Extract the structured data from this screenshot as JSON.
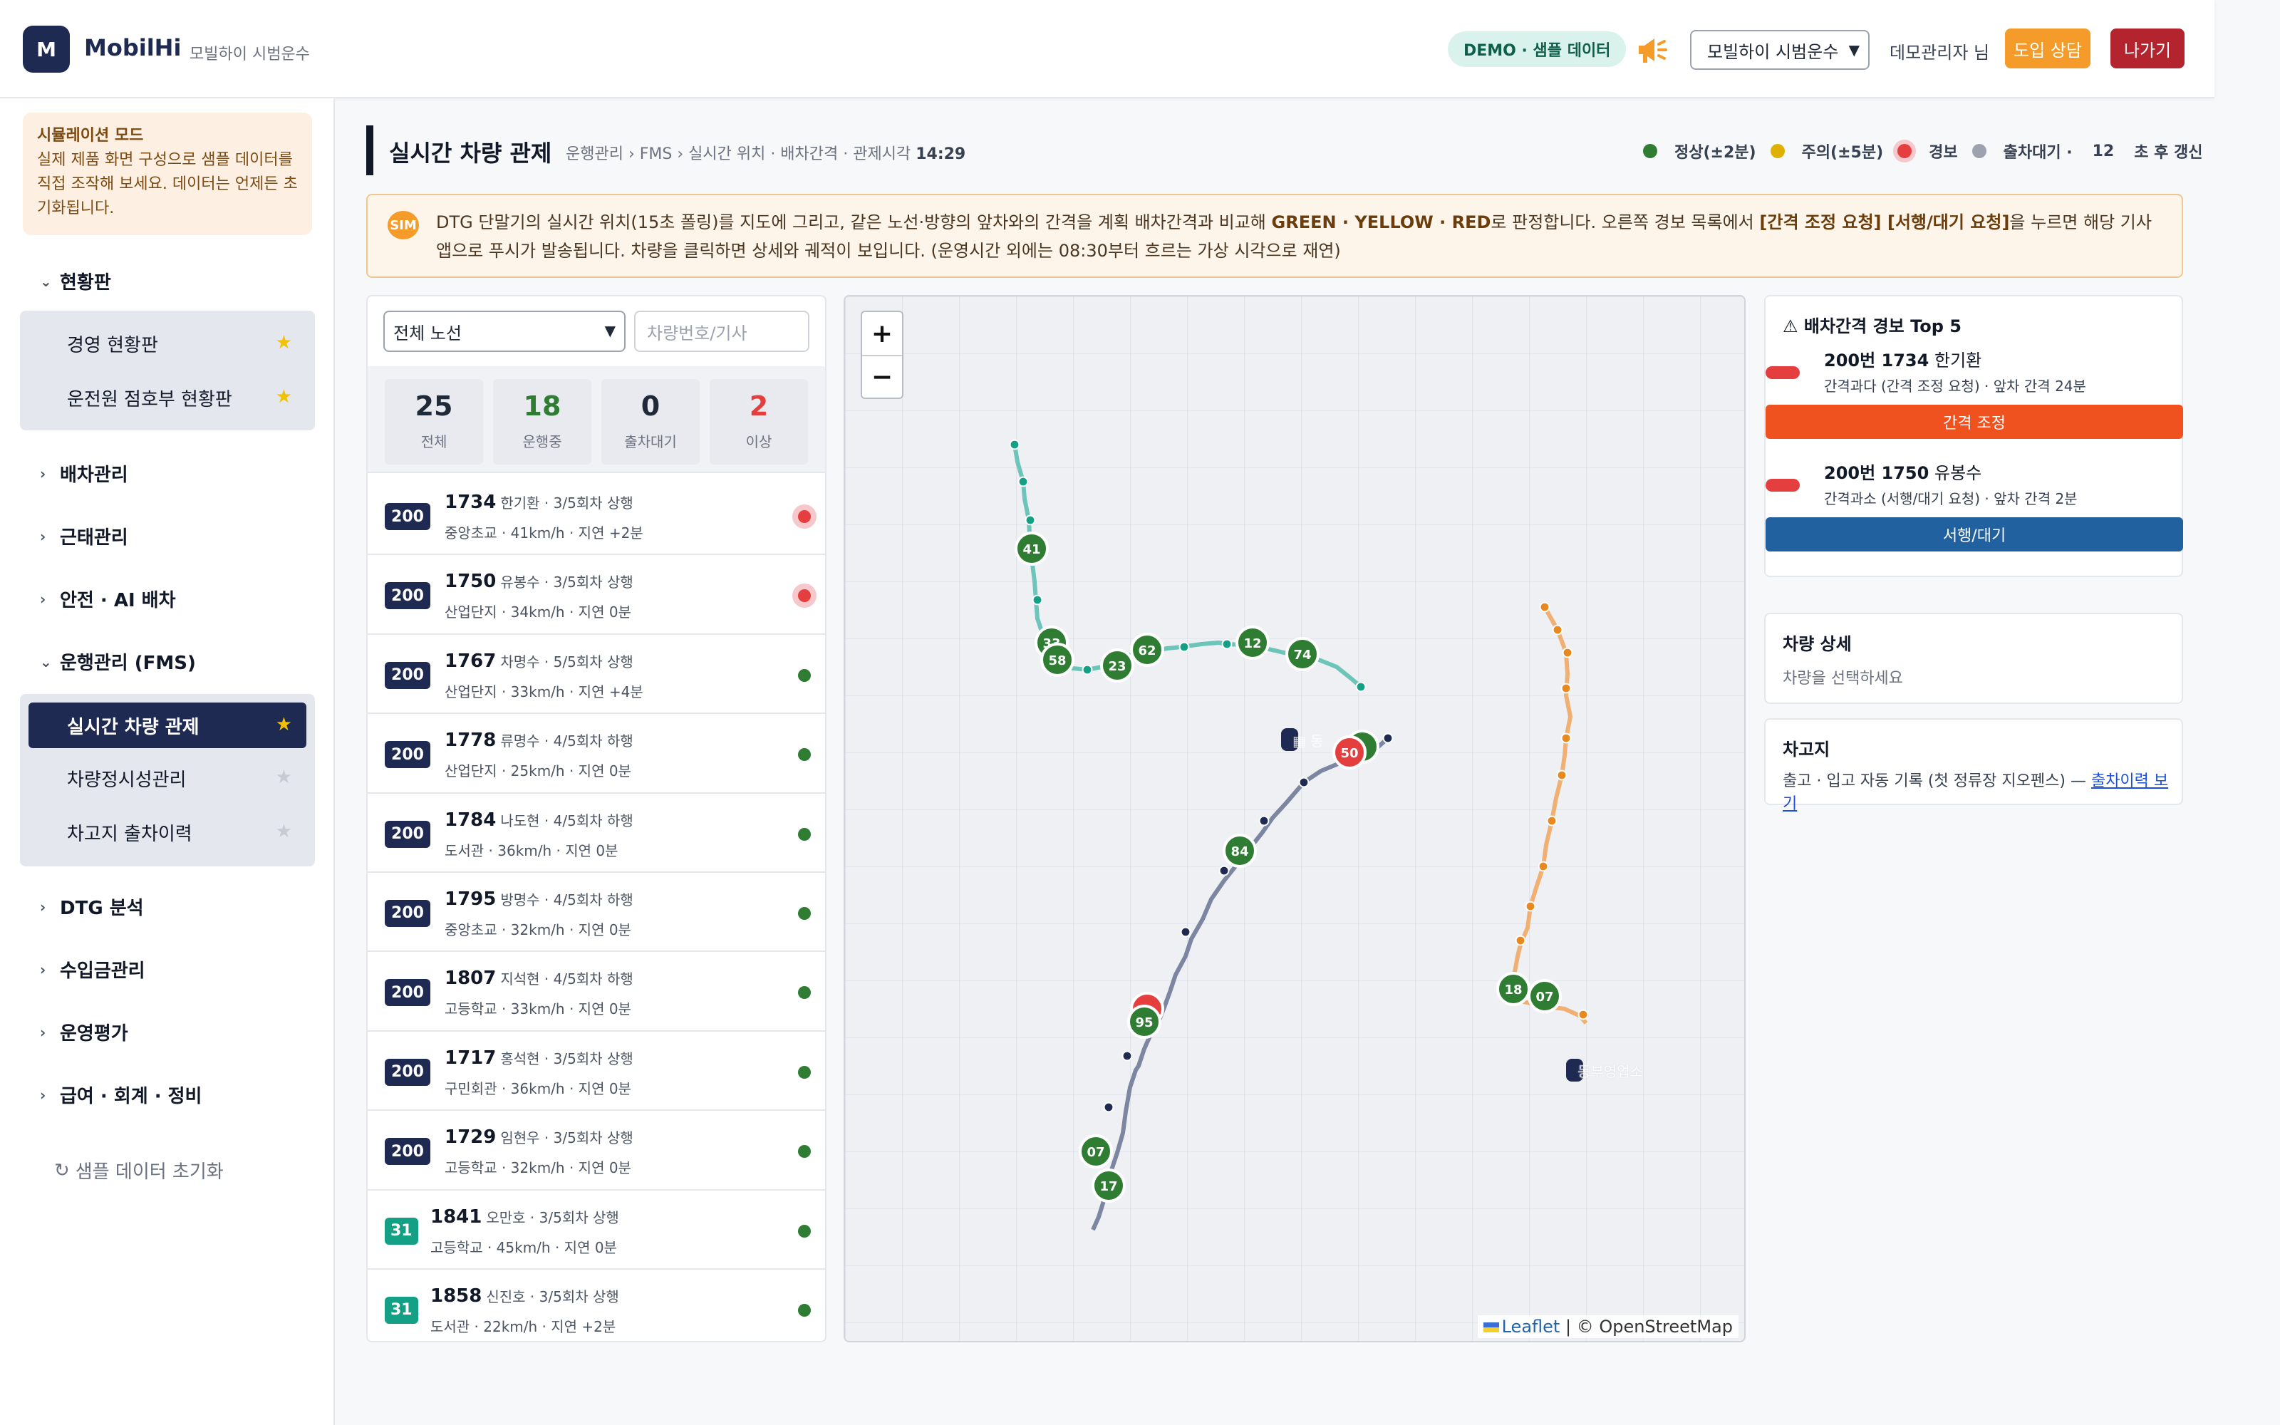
{
  "header": {
    "logo_letter": "M",
    "brand": "MobilHi",
    "brand_sub": "모빌하이 시범운수",
    "demo_badge": "DEMO · 샘플 데이터",
    "company_select": "모빌하이 시범운수",
    "admin": "데모관리자 님",
    "consult_button": "도입 상담",
    "exit_button": "나가기"
  },
  "sidebar": {
    "sim_title": "시뮬레이션 모드",
    "sim_text": "실제 제품 화면 구성으로 샘플 데이터를 직접 조작해 보세요. 데이터는 언제든 초기화됩니다.",
    "sections": [
      {
        "label": "현황판",
        "expanded": true,
        "items": [
          {
            "label": "경영 현황판",
            "starred": true
          },
          {
            "label": "운전원 점호부 현황판",
            "starred": true
          }
        ]
      },
      {
        "label": "배차관리",
        "expanded": false
      },
      {
        "label": "근태관리",
        "expanded": false
      },
      {
        "label": "안전 · AI 배차",
        "expanded": false
      },
      {
        "label": "운행관리 (FMS)",
        "expanded": true,
        "items": [
          {
            "label": "실시간 차량 관제",
            "starred": true,
            "active": true
          },
          {
            "label": "차량정시성관리",
            "starred": false
          },
          {
            "label": "차고지 출차이력",
            "starred": false
          }
        ]
      },
      {
        "label": "DTG 분석",
        "expanded": false
      },
      {
        "label": "수입금관리",
        "expanded": false
      },
      {
        "label": "운영평가",
        "expanded": false
      },
      {
        "label": "급여 · 회계 · 정비",
        "expanded": false
      }
    ],
    "reset_label": "샘플 데이터 초기화"
  },
  "page": {
    "title": "실시간 차량 관제",
    "breadcrumb": "운행관리 › FMS › 실시간 위치 · 배차간격 · 관제시각",
    "clock": "14:29",
    "legend": [
      {
        "label": "정상(±2분)",
        "color": "#2e7d32"
      },
      {
        "label": "주의(±5분)",
        "color": "#e0b000"
      },
      {
        "label": "경보",
        "color": "#e53e3e"
      },
      {
        "label": "출차대기 ·",
        "color": "#9ca3af"
      }
    ],
    "refresh_count": "12",
    "refresh_label": "초 후 갱신"
  },
  "banner": {
    "badge": "SIM",
    "t1": "DTG 단말기의 실시간 위치(15초 폴링)를 지도에 그리고, 같은 노선·방향의 앞차와의 간격을 계획 배차간격과 비교해 ",
    "t2": "GREEN · YELLOW · RED",
    "t3": "로 판정합니다. 오른쪽 경보 목록에서 ",
    "t4": "[간격 조정 요청] [서행/대기 요청]",
    "t5": "을 누르면 해당 기사 앱으로 푸시가 발송됩니다. 차량을 클릭하면 상세와 궤적이 보입니다. (운영시간 외에는 08:30부터 흐르는 가상 시각으로 재연)"
  },
  "list": {
    "route_select": "전체 노선",
    "search_placeholder": "차량번호/기사",
    "stats": [
      {
        "value": "25",
        "label": "전체",
        "color": "#1f2937"
      },
      {
        "value": "18",
        "label": "운행중",
        "color": "#2e7d32"
      },
      {
        "value": "0",
        "label": "출차대기",
        "color": "#1f2937"
      },
      {
        "value": "2",
        "label": "이상",
        "color": "#e53e3e"
      }
    ],
    "vehicles": [
      {
        "route": "200",
        "no": "1734",
        "driver": "한기환 · 3/5회차 상행",
        "detail": "중앙초교 · 41km/h · 지연 +2분",
        "status": "alert"
      },
      {
        "route": "200",
        "no": "1750",
        "driver": "유봉수 · 3/5회차 상행",
        "detail": "산업단지 · 34km/h · 지연 0분",
        "status": "alert"
      },
      {
        "route": "200",
        "no": "1767",
        "driver": "차명수 · 5/5회차 상행",
        "detail": "산업단지 · 33km/h · 지연 +4분",
        "status": "ok"
      },
      {
        "route": "200",
        "no": "1778",
        "driver": "류명수 · 4/5회차 하행",
        "detail": "산업단지 · 25km/h · 지연 0분",
        "status": "ok"
      },
      {
        "route": "200",
        "no": "1784",
        "driver": "나도현 · 4/5회차 하행",
        "detail": "도서관 · 36km/h · 지연 0분",
        "status": "ok"
      },
      {
        "route": "200",
        "no": "1795",
        "driver": "방명수 · 4/5회차 하행",
        "detail": "중앙초교 · 32km/h · 지연 0분",
        "status": "ok"
      },
      {
        "route": "200",
        "no": "1807",
        "driver": "지석현 · 4/5회차 하행",
        "detail": "고등학교 · 33km/h · 지연 0분",
        "status": "ok"
      },
      {
        "route": "200",
        "no": "1717",
        "driver": "홍석현 · 3/5회차 상행",
        "detail": "구민회관 · 36km/h · 지연 0분",
        "status": "ok"
      },
      {
        "route": "200",
        "no": "1729",
        "driver": "임현우 · 3/5회차 상행",
        "detail": "고등학교 · 32km/h · 지연 0분",
        "status": "ok"
      },
      {
        "route": "31",
        "no": "1841",
        "driver": "오만호 · 3/5회차 상행",
        "detail": "고등학교 · 45km/h · 지연 0분",
        "status": "ok"
      },
      {
        "route": "31",
        "no": "1858",
        "driver": "신진호 · 3/5회차 상행",
        "detail": "도서관 · 22km/h · 지연 +2분",
        "status": "ok"
      }
    ]
  },
  "map": {
    "zoom_in": "+",
    "zoom_out": "−",
    "attribution_leaflet": "Leaflet",
    "attribution_rest": "| © OpenStreetMap",
    "garage_label": "동부영업소",
    "markers": [
      "41",
      "33",
      "58",
      "23",
      "62",
      "12",
      "74",
      "50",
      "84",
      "95",
      "07",
      "17",
      "18",
      "07"
    ]
  },
  "alerts": {
    "title": "배차간격 경보 Top 5",
    "items": [
      {
        "bus": "200번 1734",
        "driver": "한기환",
        "desc": "간격과다 (간격 조정 요청) · 앞차 간격 24분",
        "button": "간격 조정",
        "button_color": "#f0521f"
      },
      {
        "bus": "200번 1750",
        "driver": "유봉수",
        "desc": "간격과소 (서행/대기 요청) · 앞차 간격 2분",
        "button": "서행/대기",
        "button_color": "#22619f"
      }
    ]
  },
  "detail": {
    "title": "차량 상세",
    "text": "차량을 선택하세요"
  },
  "garage": {
    "title": "차고지",
    "text": "출고 · 입고 자동 기록 (첫 정류장 지오펜스) — ",
    "link": "출차이력 보기"
  }
}
